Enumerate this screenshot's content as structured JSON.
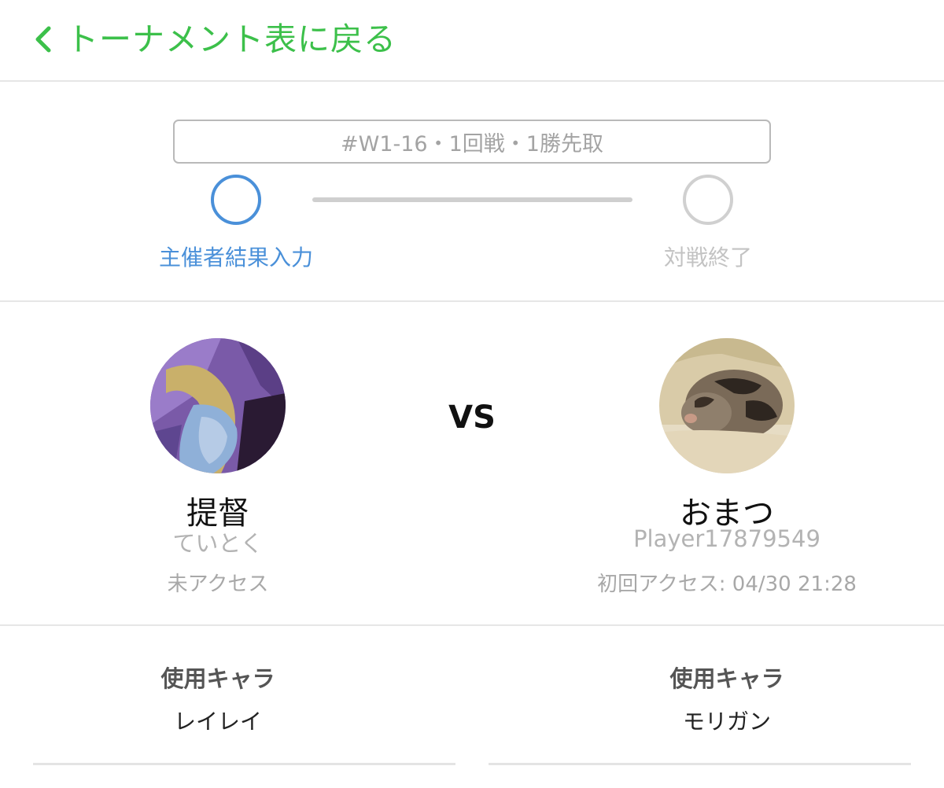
{
  "header": {
    "back_label": "トーナメント表に戻る"
  },
  "status": {
    "match_info": "#W1-16・1回戦・1勝先取",
    "steps": [
      {
        "label": "主催者結果入力",
        "state": "active"
      },
      {
        "label": "対戦終了",
        "state": "inactive"
      }
    ]
  },
  "vs_label": "VS",
  "players": [
    {
      "name": "提督",
      "username": "ていとく",
      "access": "未アクセス"
    },
    {
      "name": "おまつ",
      "username": "Player17879549",
      "access": "初回アクセス: 04/30 21:28"
    }
  ],
  "characters": [
    {
      "title": "使用キャラ",
      "value": "レイレイ"
    },
    {
      "title": "使用キャラ",
      "value": "モリガン"
    }
  ],
  "colors": {
    "accent_green": "#3cc04a",
    "active_blue": "#4a90d9",
    "inactive_gray": "#d0d0d0"
  }
}
